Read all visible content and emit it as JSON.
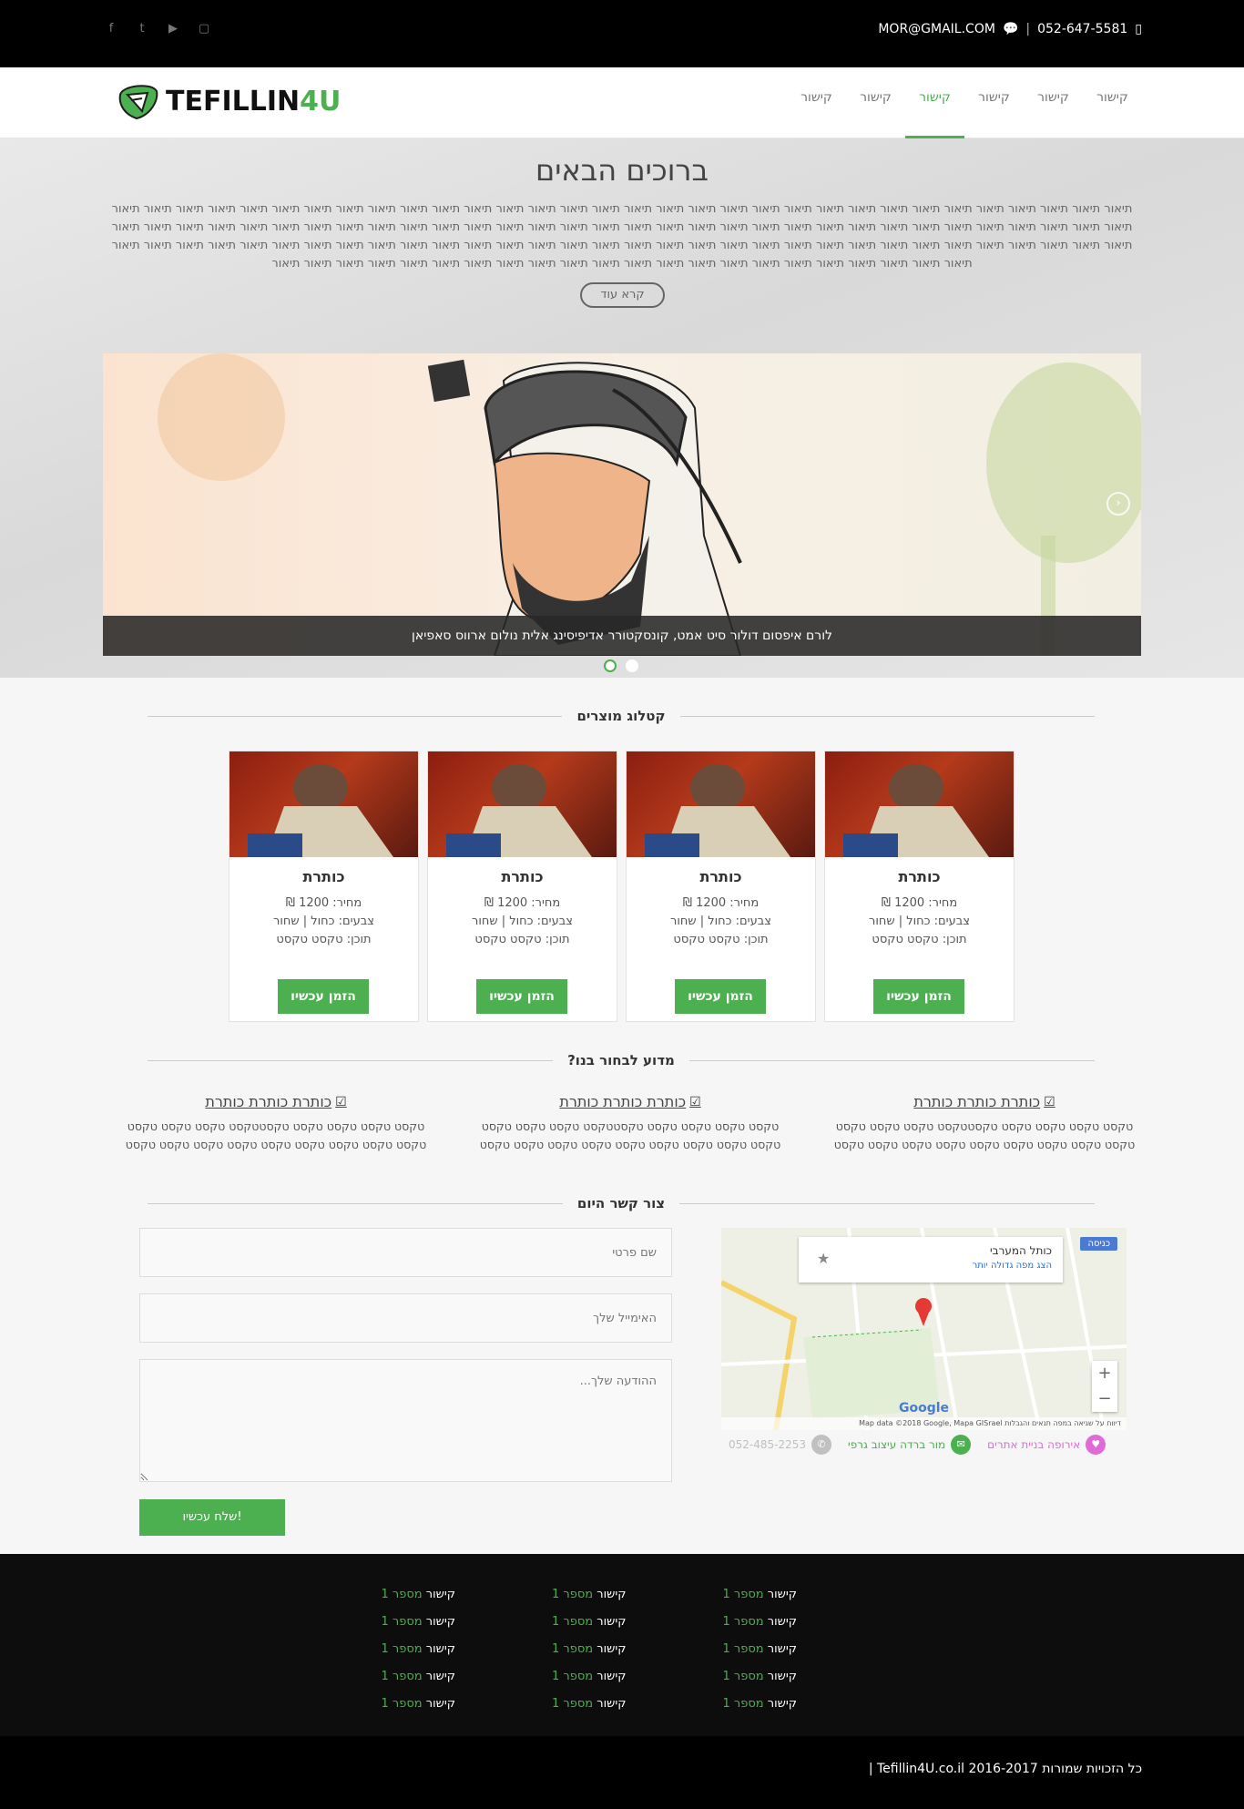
{
  "topbar": {
    "phone": "052-647-5581",
    "email": "MOR@GMAIL.COM",
    "separator": "|",
    "social": [
      "facebook-icon",
      "twitter-icon",
      "youtube-icon",
      "twitch-icon"
    ],
    "social_glyphs": [
      "f",
      "t",
      "▶",
      "▢"
    ]
  },
  "logo": {
    "text_main": "TEFILLIN",
    "text_accent": "4U"
  },
  "nav": {
    "items": [
      "קישור",
      "קישור",
      "קישור",
      "קישור",
      "קישור",
      "קישור"
    ],
    "active_index": 3
  },
  "hero": {
    "title": "ברוכים הבאים",
    "intro": "תיאור תיאור תיאור תיאור תיאור תיאור תיאור תיאור תיאור תיאור תיאור תיאור תיאור תיאור תיאור תיאור תיאור תיאור תיאור תיאור תיאור תיאור תיאור תיאור תיאור תיאור תיאור תיאור תיאור תיאור תיאור תיאור תיאור תיאור תיאור תיאור תיאור תיאור תיאור תיאור תיאור תיאור תיאור תיאור תיאור תיאור תיאור תיאור תיאור תיאור תיאור תיאור תיאור תיאור תיאור תיאור תיאור תיאור תיאור תיאור תיאור תיאור תיאור תיאור תיאור תיאור תיאור תיאור תיאור תיאור תיאור תיאור תיאור תיאור תיאור תיאור תיאור תיאור תיאור תיאור תיאור תיאור תיאור תיאור תיאור תיאור תיאור תיאור תיאור תיאור תיאור תיאור תיאור תיאור תיאור תיאור תיאור תיאור תיאור תיאור תיאור תיאור תיאור תיאור תיאור תיאור תיאור תיאור תיאור תיאור תיאור תיאור תיאור תיאור תיאור תיאור תיאור תיאור",
    "more_button": "קרא עוד",
    "slide_caption": "לורם איפסום דולור סיט אמט, קונסקטורר אדיפיסינג אלית נולום ארווס סאפיאן",
    "next_arrow": "›"
  },
  "catalog": {
    "title": "קטלוג מוצרים",
    "products": [
      {
        "title": "כותרת",
        "price": "מחיר: 1200 ₪",
        "colors": "צבעים: כחול | שחור",
        "content": "תוכן: טקסט טקסט",
        "button": "הזמן עכשיו"
      },
      {
        "title": "כותרת",
        "price": "מחיר: 1200 ₪",
        "colors": "צבעים: כחול | שחור",
        "content": "תוכן: טקסט טקסט",
        "button": "הזמן עכשיו"
      },
      {
        "title": "כותרת",
        "price": "מחיר: 1200 ₪",
        "colors": "צבעים: כחול | שחור",
        "content": "תוכן: טקסט טקסט",
        "button": "הזמן עכשיו"
      },
      {
        "title": "כותרת",
        "price": "מחיר: 1200 ₪",
        "colors": "צבעים: כחול | שחור",
        "content": "תוכן: טקסט טקסט",
        "button": "הזמן עכשיו"
      }
    ]
  },
  "why": {
    "title": "מדוע לבחור בנו?",
    "items": [
      {
        "title": "כותרת כותרת כותרת",
        "text": "טקסט טקסט טקסט טקסט טקסטטקסט טקסט טקסט טקסט טקסט טקסט טקסט טקסט טקסט טקסט טקסט טקסט טקסט"
      },
      {
        "title": "כותרת כותרת כותרת",
        "text": "טקסט טקסט טקסט טקסט טקסטטקסט טקסט טקסט טקסט טקסט טקסט טקסט טקסט טקסט טקסט טקסט טקסט טקסט"
      },
      {
        "title": "כותרת כותרת כותרת",
        "text": "טקסט טקסט טקסט טקסט טקסטטקסט טקסט טקסט טקסט טקסט טקסט טקסט טקסט טקסט טקסט טקסט טקסט טקסט"
      }
    ]
  },
  "contact": {
    "title": "צור קשר היום",
    "name_placeholder": "שם פרטי",
    "email_placeholder": "האימייל שלך",
    "message_placeholder": "ההודעה שלך...",
    "send_button": "שלח עכשיו!",
    "map": {
      "place": "כותל המערבי",
      "larger_map": "הצג מפה גדולה יותר",
      "enter": "כניסה",
      "attribution": "Map data ©2018 Google, Mapa GISrael",
      "terms": "תנאים והגבלות",
      "report": "דיווח על שגיאה במפה",
      "brand": "Google"
    },
    "phone": "052-485-2253",
    "designer": "מור ברדה עיצוב גרפי",
    "builder": "אירופה בניית אתרים"
  },
  "footer": {
    "columns": [
      [
        {
          "label": "קישור",
          "num": "מספר 1"
        },
        {
          "label": "קישור",
          "num": "מספר 1"
        },
        {
          "label": "קישור",
          "num": "מספר 1"
        },
        {
          "label": "קישור",
          "num": "מספר 1"
        },
        {
          "label": "קישור",
          "num": "מספר 1"
        }
      ],
      [
        {
          "label": "קישור",
          "num": "מספר 1"
        },
        {
          "label": "קישור",
          "num": "מספר 1"
        },
        {
          "label": "קישור",
          "num": "מספר 1"
        },
        {
          "label": "קישור",
          "num": "מספר 1"
        },
        {
          "label": "קישור",
          "num": "מספר 1"
        }
      ],
      [
        {
          "label": "קישור",
          "num": "מספר 1"
        },
        {
          "label": "קישור",
          "num": "מספר 1"
        },
        {
          "label": "קישור",
          "num": "מספר 1"
        },
        {
          "label": "קישור",
          "num": "מספר 1"
        },
        {
          "label": "קישור",
          "num": "מספר 1"
        }
      ]
    ],
    "copyright": "כל הזכויות שמורות 2016-2017 Tefillin4U.co.il"
  },
  "colors": {
    "accent": "#4caf50",
    "topbar": "#000000",
    "footer": "#0d0d0d"
  }
}
